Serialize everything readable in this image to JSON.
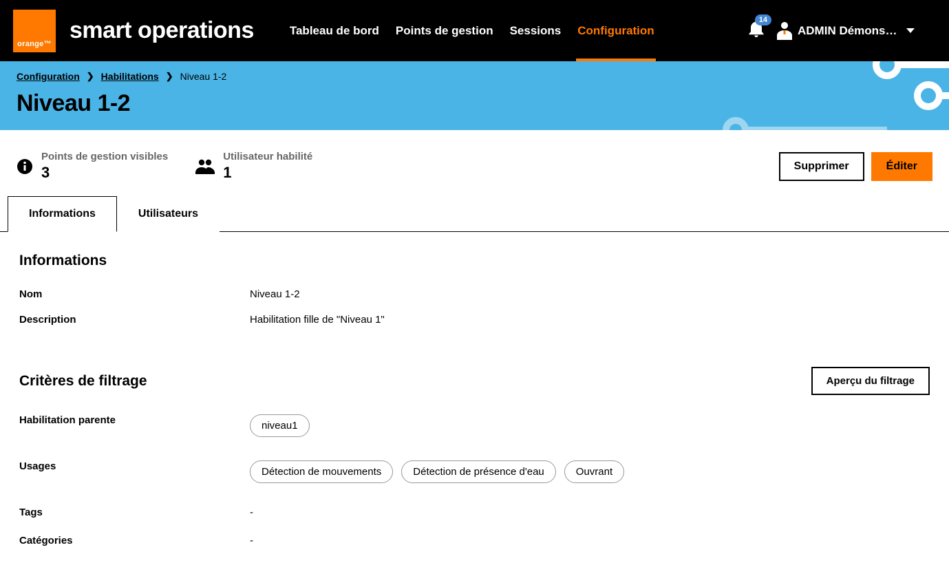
{
  "header": {
    "logo_text": "orange™",
    "app_title": "smart operations",
    "nav": {
      "dashboard": "Tableau de bord",
      "points": "Points de gestion",
      "sessions": "Sessions",
      "config": "Configuration"
    },
    "notification_count": "14",
    "user_name": "ADMIN Démonstr..."
  },
  "breadcrumb": {
    "config": "Configuration",
    "habilitations": "Habilitations",
    "current": "Niveau 1-2"
  },
  "page_title": "Niveau 1-2",
  "stats": {
    "points_label": "Points de gestion visibles",
    "points_value": "3",
    "users_label": "Utilisateur habilité",
    "users_value": "1"
  },
  "actions": {
    "delete": "Supprimer",
    "edit": "Éditer"
  },
  "tabs": {
    "info": "Informations",
    "users": "Utilisateurs"
  },
  "sections": {
    "info_title": "Informations",
    "filter_title": "Critères de filtrage",
    "preview_filter": "Aperçu du filtrage"
  },
  "fields": {
    "name_label": "Nom",
    "name_value": "Niveau 1-2",
    "desc_label": "Description",
    "desc_value": "Habilitation fille de \"Niveau 1\"",
    "parent_label": "Habilitation parente",
    "parent_chip": "niveau1",
    "usages_label": "Usages",
    "usage_1": "Détection de mouvements",
    "usage_2": "Détection de présence d'eau",
    "usage_3": "Ouvrant",
    "tags_label": "Tags",
    "tags_value": "-",
    "cat_label": "Catégories",
    "cat_value": "-"
  }
}
